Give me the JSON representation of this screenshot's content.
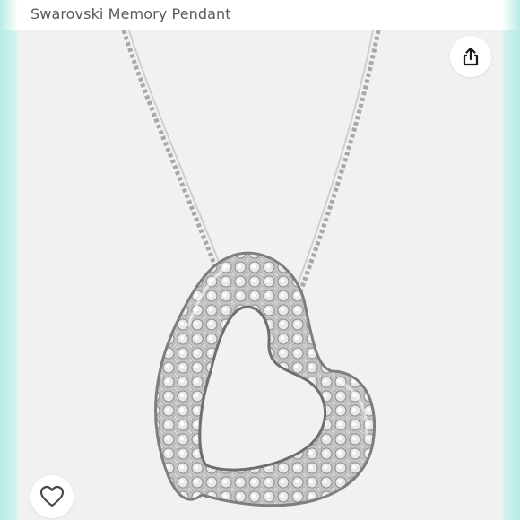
{
  "header": {
    "title": "Swarovski Memory Pendant"
  },
  "product": {
    "image_alt": "Silver heart pendant necklace with pavé crystals"
  },
  "actions": {
    "share_icon": "share-icon",
    "favorite_icon": "heart-outline-icon"
  },
  "colors": {
    "accent_edge": "#b9ece6",
    "icon": "#1a1a1a"
  }
}
